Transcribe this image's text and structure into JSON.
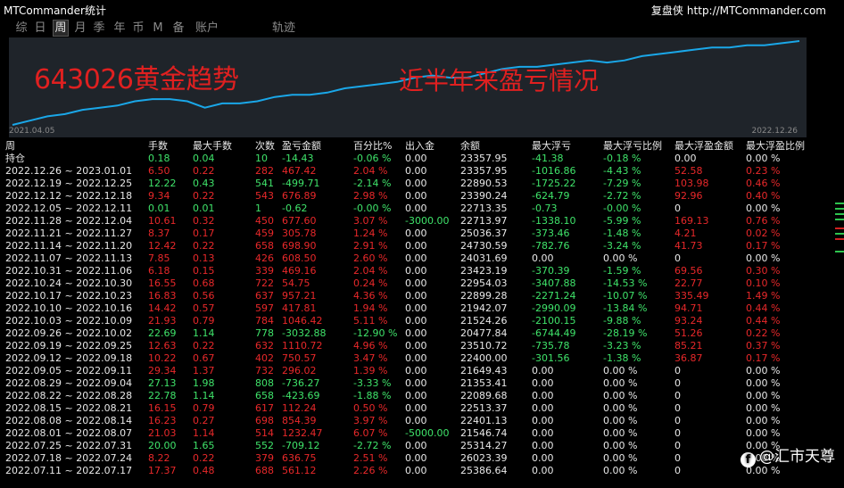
{
  "window": {
    "title": "MTCommander统计",
    "brand_cn": "复盘侠",
    "brand_url": "http://MTCommander.com"
  },
  "tabs": [
    {
      "label": "综",
      "active": false
    },
    {
      "label": "日",
      "active": false
    },
    {
      "label": "周",
      "active": true
    },
    {
      "label": "月",
      "active": false
    },
    {
      "label": "季",
      "active": false
    },
    {
      "label": "年",
      "active": false
    },
    {
      "label": "币",
      "active": false
    },
    {
      "label": "M",
      "active": false
    },
    {
      "label": "备",
      "active": false
    },
    {
      "label": "账户",
      "active": false
    },
    {
      "label": "轨迹",
      "active": false
    }
  ],
  "chart": {
    "account_overlay": "643026黄金趋势",
    "caption_overlay": "近半年来盈亏情况",
    "date_start": "2021.04.05",
    "date_end": "2022.12.26",
    "line_color": "#1aa7e8"
  },
  "chart_data": {
    "type": "line",
    "x_start": "2021.04.05",
    "x_end": "2022.12.26",
    "series": [
      {
        "values": [
          0,
          2,
          4,
          5,
          7,
          8,
          9,
          11,
          12,
          12,
          11,
          8,
          10,
          10,
          11,
          13,
          14,
          14,
          15,
          17,
          18,
          19,
          20,
          22,
          23,
          22,
          22,
          24,
          26,
          27,
          27,
          28,
          29,
          30,
          29,
          30,
          32,
          33,
          34,
          35,
          36,
          36,
          37,
          37,
          38,
          39
        ]
      }
    ]
  },
  "table": {
    "headers": [
      "周",
      "手数",
      "最大手数",
      "次数",
      "盈亏金额",
      "百分比%",
      "出入金",
      "余额",
      "最大浮亏",
      "最大浮亏比例",
      "最大浮盈金额",
      "最大浮盈比例"
    ],
    "rows": [
      {
        "cells": [
          "持仓",
          "0.18",
          "0.04",
          "10",
          "-14.43",
          "-0.06 %",
          "0.00",
          "23357.95",
          "-41.38",
          "-0.18 %",
          "0.00",
          "0.00 %"
        ],
        "colors": [
          "w",
          "g",
          "g",
          "g",
          "g",
          "g",
          "w",
          "w",
          "g",
          "g",
          "w",
          "w"
        ]
      },
      {
        "cells": [
          "2022.12.26 ~ 2023.01.01",
          "6.50",
          "0.22",
          "282",
          "467.42",
          "2.04 %",
          "0.00",
          "23357.95",
          "-1016.86",
          "-4.43 %",
          "52.58",
          "0.23 %"
        ],
        "colors": [
          "w",
          "r",
          "r",
          "r",
          "r",
          "r",
          "w",
          "w",
          "g",
          "g",
          "r",
          "r"
        ]
      },
      {
        "cells": [
          "2022.12.19 ~ 2022.12.25",
          "12.22",
          "0.43",
          "541",
          "-499.71",
          "-2.14 %",
          "0.00",
          "22890.53",
          "-1725.22",
          "-7.29 %",
          "103.98",
          "0.46 %"
        ],
        "colors": [
          "w",
          "g",
          "g",
          "g",
          "g",
          "g",
          "w",
          "w",
          "g",
          "g",
          "r",
          "r"
        ]
      },
      {
        "cells": [
          "2022.12.12 ~ 2022.12.18",
          "9.34",
          "0.22",
          "543",
          "676.89",
          "2.98 %",
          "0.00",
          "23390.24",
          "-624.79",
          "-2.72 %",
          "92.96",
          "0.40 %"
        ],
        "colors": [
          "w",
          "r",
          "r",
          "r",
          "r",
          "r",
          "w",
          "w",
          "g",
          "g",
          "r",
          "r"
        ]
      },
      {
        "cells": [
          "2022.12.05 ~ 2022.12.11",
          "0.01",
          "0.01",
          "1",
          "-0.62",
          "-0.00 %",
          "0.00",
          "22713.35",
          "-0.73",
          "-0.00 %",
          "0",
          "0.00 %"
        ],
        "colors": [
          "w",
          "g",
          "g",
          "g",
          "g",
          "g",
          "w",
          "w",
          "g",
          "g",
          "w",
          "w"
        ]
      },
      {
        "cells": [
          "2022.11.28 ~ 2022.12.04",
          "10.61",
          "0.32",
          "450",
          "677.60",
          "3.07 %",
          "-3000.00",
          "22713.97",
          "-1338.10",
          "-5.99 %",
          "169.13",
          "0.76 %"
        ],
        "colors": [
          "w",
          "r",
          "r",
          "r",
          "r",
          "r",
          "g",
          "w",
          "g",
          "g",
          "r",
          "r"
        ]
      },
      {
        "cells": [
          "2022.11.21 ~ 2022.11.27",
          "8.37",
          "0.17",
          "459",
          "305.78",
          "1.24 %",
          "0.00",
          "25036.37",
          "-373.46",
          "-1.48 %",
          "4.21",
          "0.02 %"
        ],
        "colors": [
          "w",
          "r",
          "r",
          "r",
          "r",
          "r",
          "w",
          "w",
          "g",
          "g",
          "r",
          "r"
        ]
      },
      {
        "cells": [
          "2022.11.14 ~ 2022.11.20",
          "12.42",
          "0.22",
          "658",
          "698.90",
          "2.91 %",
          "0.00",
          "24730.59",
          "-782.76",
          "-3.24 %",
          "41.73",
          "0.17 %"
        ],
        "colors": [
          "w",
          "r",
          "r",
          "r",
          "r",
          "r",
          "w",
          "w",
          "g",
          "g",
          "r",
          "r"
        ]
      },
      {
        "cells": [
          "2022.11.07 ~ 2022.11.13",
          "7.85",
          "0.13",
          "426",
          "608.50",
          "2.60 %",
          "0.00",
          "24031.69",
          "0.00",
          "0.00 %",
          "0",
          "0.00 %"
        ],
        "colors": [
          "w",
          "r",
          "r",
          "r",
          "r",
          "r",
          "w",
          "w",
          "w",
          "w",
          "w",
          "w"
        ]
      },
      {
        "cells": [
          "2022.10.31 ~ 2022.11.06",
          "6.18",
          "0.15",
          "339",
          "469.16",
          "2.04 %",
          "0.00",
          "23423.19",
          "-370.39",
          "-1.59 %",
          "69.56",
          "0.30 %"
        ],
        "colors": [
          "w",
          "r",
          "r",
          "r",
          "r",
          "r",
          "w",
          "w",
          "g",
          "g",
          "r",
          "r"
        ]
      },
      {
        "cells": [
          "2022.10.24 ~ 2022.10.30",
          "16.55",
          "0.68",
          "722",
          "54.75",
          "0.24 %",
          "0.00",
          "22954.03",
          "-3407.88",
          "-14.53 %",
          "22.77",
          "0.10 %"
        ],
        "colors": [
          "w",
          "r",
          "r",
          "r",
          "r",
          "r",
          "w",
          "w",
          "g",
          "g",
          "r",
          "r"
        ]
      },
      {
        "cells": [
          "2022.10.17 ~ 2022.10.23",
          "16.83",
          "0.56",
          "637",
          "957.21",
          "4.36 %",
          "0.00",
          "22899.28",
          "-2271.24",
          "-10.07 %",
          "335.49",
          "1.49 %"
        ],
        "colors": [
          "w",
          "r",
          "r",
          "r",
          "r",
          "r",
          "w",
          "w",
          "g",
          "g",
          "r",
          "r"
        ]
      },
      {
        "cells": [
          "2022.10.10 ~ 2022.10.16",
          "14.42",
          "0.57",
          "597",
          "417.81",
          "1.94 %",
          "0.00",
          "21942.07",
          "-2990.09",
          "-13.84 %",
          "94.71",
          "0.44 %"
        ],
        "colors": [
          "w",
          "r",
          "r",
          "r",
          "r",
          "r",
          "w",
          "w",
          "g",
          "g",
          "r",
          "r"
        ]
      },
      {
        "cells": [
          "2022.10.03 ~ 2022.10.09",
          "21.93",
          "0.79",
          "784",
          "1046.42",
          "5.11 %",
          "0.00",
          "21524.26",
          "-2100.15",
          "-9.88 %",
          "93.24",
          "0.44 %"
        ],
        "colors": [
          "w",
          "r",
          "r",
          "r",
          "r",
          "r",
          "w",
          "w",
          "g",
          "g",
          "r",
          "r"
        ]
      },
      {
        "cells": [
          "2022.09.26 ~ 2022.10.02",
          "22.69",
          "1.14",
          "778",
          "-3032.88",
          "-12.90 %",
          "0.00",
          "20477.84",
          "-6744.49",
          "-28.19 %",
          "51.26",
          "0.22 %"
        ],
        "colors": [
          "w",
          "g",
          "g",
          "g",
          "g",
          "g",
          "w",
          "w",
          "g",
          "g",
          "r",
          "r"
        ]
      },
      {
        "cells": [
          "2022.09.19 ~ 2022.09.25",
          "12.63",
          "0.22",
          "632",
          "1110.72",
          "4.96 %",
          "0.00",
          "23510.72",
          "-735.78",
          "-3.23 %",
          "85.21",
          "0.37 %"
        ],
        "colors": [
          "w",
          "r",
          "r",
          "r",
          "r",
          "r",
          "w",
          "w",
          "g",
          "g",
          "r",
          "r"
        ]
      },
      {
        "cells": [
          "2022.09.12 ~ 2022.09.18",
          "10.22",
          "0.67",
          "402",
          "750.57",
          "3.47 %",
          "0.00",
          "22400.00",
          "-301.56",
          "-1.38 %",
          "36.87",
          "0.17 %"
        ],
        "colors": [
          "w",
          "r",
          "r",
          "r",
          "r",
          "r",
          "w",
          "w",
          "g",
          "g",
          "r",
          "r"
        ]
      },
      {
        "cells": [
          "2022.09.05 ~ 2022.09.11",
          "29.34",
          "1.37",
          "732",
          "296.02",
          "1.39 %",
          "0.00",
          "21649.43",
          "0.00",
          "0.00 %",
          "0",
          "0.00 %"
        ],
        "colors": [
          "w",
          "r",
          "r",
          "r",
          "r",
          "r",
          "w",
          "w",
          "w",
          "w",
          "w",
          "w"
        ]
      },
      {
        "cells": [
          "2022.08.29 ~ 2022.09.04",
          "27.13",
          "1.98",
          "808",
          "-736.27",
          "-3.33 %",
          "0.00",
          "21353.41",
          "0.00",
          "0.00 %",
          "0",
          "0.00 %"
        ],
        "colors": [
          "w",
          "g",
          "g",
          "g",
          "g",
          "g",
          "w",
          "w",
          "w",
          "w",
          "w",
          "w"
        ]
      },
      {
        "cells": [
          "2022.08.22 ~ 2022.08.28",
          "22.78",
          "1.14",
          "658",
          "-423.69",
          "-1.88 %",
          "0.00",
          "22089.68",
          "0.00",
          "0.00 %",
          "0",
          "0.00 %"
        ],
        "colors": [
          "w",
          "g",
          "g",
          "g",
          "g",
          "g",
          "w",
          "w",
          "w",
          "w",
          "w",
          "w"
        ]
      },
      {
        "cells": [
          "2022.08.15 ~ 2022.08.21",
          "16.15",
          "0.79",
          "617",
          "112.24",
          "0.50 %",
          "0.00",
          "22513.37",
          "0.00",
          "0.00 %",
          "0",
          "0.00 %"
        ],
        "colors": [
          "w",
          "r",
          "r",
          "r",
          "r",
          "r",
          "w",
          "w",
          "w",
          "w",
          "w",
          "w"
        ]
      },
      {
        "cells": [
          "2022.08.08 ~ 2022.08.14",
          "16.23",
          "0.27",
          "698",
          "854.39",
          "3.97 %",
          "0.00",
          "22401.13",
          "0.00",
          "0.00 %",
          "0",
          "0.00 %"
        ],
        "colors": [
          "w",
          "r",
          "r",
          "r",
          "r",
          "r",
          "w",
          "w",
          "w",
          "w",
          "w",
          "w"
        ]
      },
      {
        "cells": [
          "2022.08.01 ~ 2022.08.07",
          "21.03",
          "1.14",
          "514",
          "1232.47",
          "6.07 %",
          "-5000.00",
          "21546.74",
          "0.00",
          "0.00 %",
          "0",
          "0.00 %"
        ],
        "colors": [
          "w",
          "r",
          "r",
          "r",
          "r",
          "r",
          "g",
          "w",
          "w",
          "w",
          "w",
          "w"
        ]
      },
      {
        "cells": [
          "2022.07.25 ~ 2022.07.31",
          "20.00",
          "1.65",
          "552",
          "-709.12",
          "-2.72 %",
          "0.00",
          "25314.27",
          "0.00",
          "0.00 %",
          "0",
          "0.00 %"
        ],
        "colors": [
          "w",
          "g",
          "g",
          "g",
          "g",
          "g",
          "w",
          "w",
          "w",
          "w",
          "w",
          "w"
        ]
      },
      {
        "cells": [
          "2022.07.18 ~ 2022.07.24",
          "8.22",
          "0.22",
          "379",
          "636.75",
          "2.51 %",
          "0.00",
          "26023.39",
          "0.00",
          "0.00 %",
          "0",
          "0.00 %"
        ],
        "colors": [
          "w",
          "r",
          "r",
          "r",
          "r",
          "r",
          "w",
          "w",
          "w",
          "w",
          "w",
          "w"
        ]
      },
      {
        "cells": [
          "2022.07.11 ~ 2022.07.17",
          "17.37",
          "0.48",
          "688",
          "561.12",
          "2.26 %",
          "0.00",
          "25386.64",
          "0.00",
          "0.00 %",
          "0",
          "0.00 %"
        ],
        "colors": [
          "w",
          "r",
          "r",
          "r",
          "r",
          "r",
          "w",
          "w",
          "w",
          "w",
          "w",
          "w"
        ]
      }
    ]
  },
  "watermark": {
    "icon": "weibo-logo-icon",
    "text": "@汇市天尊"
  },
  "side_marks": [
    "green",
    "green",
    "green",
    "green",
    "red",
    "green",
    "red",
    "green"
  ]
}
